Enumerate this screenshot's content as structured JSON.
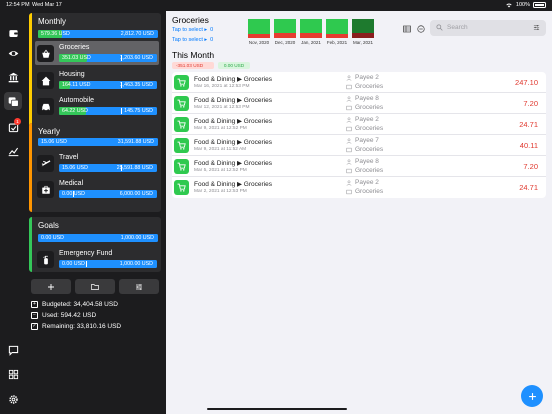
{
  "status": {
    "time": "12:54 PM",
    "date": "Wed Mar 17",
    "battery": "100%"
  },
  "rail": {
    "items": [
      {
        "icon": "wallet-icon",
        "active": false
      },
      {
        "icon": "eye-icon",
        "active": false
      },
      {
        "icon": "bank-icon",
        "active": false
      },
      {
        "icon": "envelopes-icon",
        "active": true
      },
      {
        "icon": "calendar-check-icon",
        "active": false,
        "badge": "1"
      },
      {
        "icon": "chart-line-icon",
        "active": false
      },
      {
        "icon": "chat-icon",
        "active": false
      },
      {
        "icon": "grid-icon",
        "active": false
      },
      {
        "icon": "gear-icon",
        "active": false
      }
    ]
  },
  "sidebar": {
    "monthly": {
      "title": "Monthly",
      "total_used": "579.36 USD",
      "total_budget": "2,812.70 USD",
      "items": [
        {
          "name": "Groceries",
          "used": "351.03 USD",
          "budget": "1,203.60 USD",
          "fill": 0.29,
          "icon": "basket-icon",
          "selected": true
        },
        {
          "name": "Housing",
          "used": "164.11 USD",
          "budget": "1,463.35 USD",
          "fill": 0.11,
          "icon": "house-icon",
          "selected": false
        },
        {
          "name": "Automobile",
          "used": "64.22 USD",
          "budget": "145.75 USD",
          "fill": 0.44,
          "icon": "car-icon",
          "selected": false
        }
      ]
    },
    "yearly": {
      "title": "Yearly",
      "total_used": "15.06 USD",
      "total_budget": "31,591.88 USD",
      "items": [
        {
          "name": "Travel",
          "used": "15.06 USD",
          "budget": "25,591.88 USD",
          "fill": 0.0,
          "icon": "airplane-icon",
          "selected": false
        },
        {
          "name": "Medical",
          "used": "0.00 USD",
          "budget": "6,000.00 USD",
          "fill": 0.0,
          "icon": "medical-kit-icon",
          "selected": false
        }
      ]
    },
    "goals": {
      "title": "Goals",
      "total_used": "0.00 USD",
      "total_budget": "1,000.00 USD",
      "items": [
        {
          "name": "Emergency Fund",
          "used": "0.00 USD",
          "budget": "1,000.00 USD",
          "fill": 0.0,
          "icon": "fire-extinguisher-icon",
          "selected": false
        }
      ]
    },
    "toolbar": [
      "plus-icon",
      "folder-icon",
      "sliders-icon"
    ],
    "summary": {
      "budgeted": "Budgeted: 34,404.58 USD",
      "used": "Used: 594.42 USD",
      "remaining": "Remaining: 33,810.16 USD"
    }
  },
  "main": {
    "category_title": "Groceries",
    "tap1": "Tap to select ▸",
    "tap1_value": "0",
    "tap2": "Tap to select ▸",
    "tap2_value": "0",
    "history": [
      {
        "label": "Nov, 2020",
        "spent_ratio": 0.22
      },
      {
        "label": "Dec, 2020",
        "spent_ratio": 0.26
      },
      {
        "label": "Jan, 2021",
        "spent_ratio": 0.24
      },
      {
        "label": "Feb, 2021",
        "spent_ratio": 0.21
      },
      {
        "label": "Mar, 2021",
        "spent_ratio": 0.29
      }
    ],
    "search_placeholder": "Search",
    "section_title": "This Month",
    "tag_spent": "-351.03 USD",
    "tag_income": "0.00 USD",
    "transactions": [
      {
        "title": "Food & Dining ▶ Groceries",
        "date": "Mar 16, 2021 at 12:53 PM",
        "payee": "Payee 2",
        "account": "Groceries",
        "amount": "247.10"
      },
      {
        "title": "Food & Dining ▶ Groceries",
        "date": "Mar 12, 2021 at 12:53 PM",
        "payee": "Payee 8",
        "account": "Groceries",
        "amount": "7.20"
      },
      {
        "title": "Food & Dining ▶ Groceries",
        "date": "Mar 9, 2021 at 12:52 PM",
        "payee": "Payee 2",
        "account": "Groceries",
        "amount": "24.71"
      },
      {
        "title": "Food & Dining ▶ Groceries",
        "date": "Mar 9, 2021 at 11:52 AM",
        "payee": "Payee 7",
        "account": "Groceries",
        "amount": "40.11"
      },
      {
        "title": "Food & Dining ▶ Groceries",
        "date": "Mar 5, 2021 at 12:52 PM",
        "payee": "Payee 8",
        "account": "Groceries",
        "amount": "7.20"
      },
      {
        "title": "Food & Dining ▶ Groceries",
        "date": "Mar 2, 2021 at 12:53 PM",
        "payee": "Payee 2",
        "account": "Groceries",
        "amount": "24.71"
      }
    ]
  },
  "colors": {
    "accent": "#1e90ff",
    "green": "#34c759",
    "red": "#e0382e",
    "monthly": "#ffcc00",
    "yearly": "#ff9500",
    "goals": "#34c759"
  }
}
